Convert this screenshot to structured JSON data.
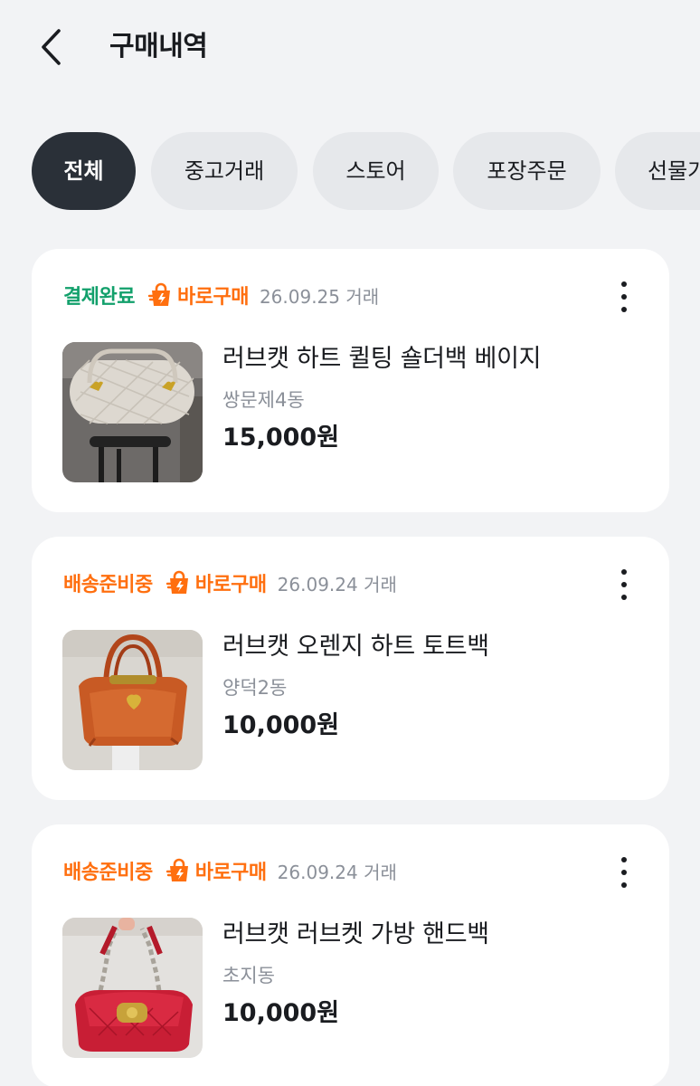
{
  "header": {
    "title": "구매내역",
    "back_icon": "chevron-left-icon"
  },
  "filters": [
    {
      "label": "전체",
      "active": true
    },
    {
      "label": "중고거래",
      "active": false
    },
    {
      "label": "스토어",
      "active": false
    },
    {
      "label": "포장주문",
      "active": false
    },
    {
      "label": "선물가",
      "active": false
    }
  ],
  "colors": {
    "background": "#f2f3f5",
    "chip_active": "#2a3038",
    "chip_inactive": "#e6e8eb",
    "status_complete": "#12a06b",
    "accent_orange": "#ff6f0f",
    "muted_text": "#8b9099"
  },
  "orders": [
    {
      "status": "결제완료",
      "badge": "바로구매",
      "date": "26.09.25 거래",
      "title": "러브캣 하트 퀼팅 숄더백 베이지",
      "location": "쌍문제4동",
      "price": "15,000원",
      "image": "beige-quilted-bag-photo"
    },
    {
      "status": "배송준비중",
      "badge": "바로구매",
      "date": "26.09.24 거래",
      "title": "러브캣 오렌지 하트 토트백",
      "location": "양덕2동",
      "price": "10,000원",
      "image": "orange-tote-bag-photo"
    },
    {
      "status": "배송준비중",
      "badge": "바로구매",
      "date": "26.09.24 거래",
      "title": "러브캣 러브켓 가방 핸드백",
      "location": "초지동",
      "price": "10,000원",
      "image": "red-handbag-photo"
    }
  ]
}
